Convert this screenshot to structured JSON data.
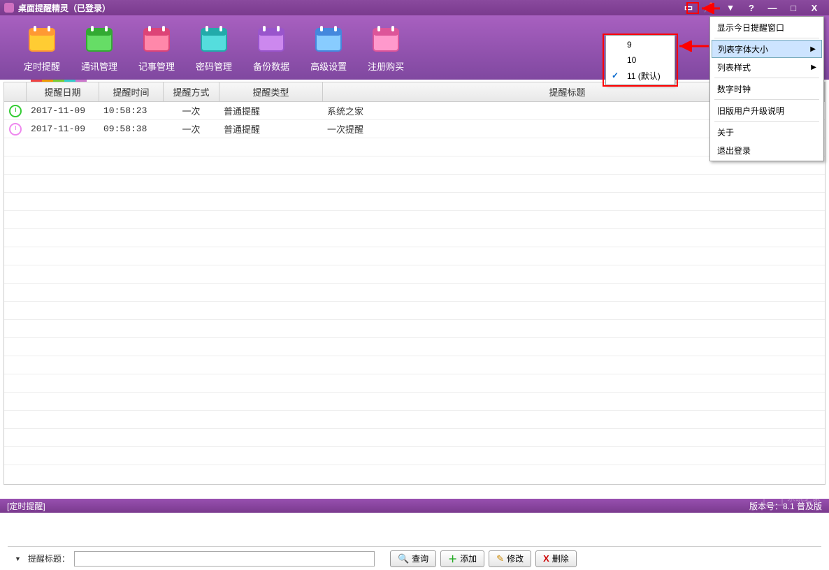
{
  "window": {
    "title": "桌面提醒精灵（已登录）"
  },
  "toolbar": [
    {
      "name": "timer-reminder",
      "label": "定时提醒",
      "color1": "#ffcc33",
      "color2": "#ff9933"
    },
    {
      "name": "contact-mgmt",
      "label": "通讯管理",
      "color1": "#66dd66",
      "color2": "#33aa33"
    },
    {
      "name": "note-mgmt",
      "label": "记事管理",
      "color1": "#ff88aa",
      "color2": "#dd4477"
    },
    {
      "name": "password-mgmt",
      "label": "密码管理",
      "color1": "#55dddd",
      "color2": "#22aaaa"
    },
    {
      "name": "backup-data",
      "label": "备份数据",
      "color1": "#cc88ee",
      "color2": "#9955cc"
    },
    {
      "name": "adv-settings",
      "label": "高级设置",
      "color1": "#88ccff",
      "color2": "#4488dd"
    },
    {
      "name": "register-buy",
      "label": "注册购买",
      "color1": "#ff99cc",
      "color2": "#dd5599"
    }
  ],
  "table": {
    "headers": {
      "date": "提醒日期",
      "time": "提醒时间",
      "mode": "提醒方式",
      "type": "提醒类型",
      "title": "提醒标题"
    },
    "rows": [
      {
        "icon": "clock-green",
        "date": "2017-11-09",
        "time": "10:58:23",
        "mode": "一次",
        "type": "普通提醒",
        "title": "系统之家"
      },
      {
        "icon": "clock-pink",
        "date": "2017-11-09",
        "time": "09:58:38",
        "mode": "一次",
        "type": "普通提醒",
        "title": "一次提醒"
      }
    ]
  },
  "search": {
    "label": "提醒标题：",
    "btn_search": "查询",
    "btn_add": "添加",
    "btn_edit": "修改",
    "btn_del": "删除"
  },
  "status": {
    "left": "[定时提醒]",
    "right": "版本号：8.1    普及版"
  },
  "menu": {
    "items": [
      {
        "label": "显示今日提醒窗口",
        "name": "show-today"
      },
      {
        "label": "列表字体大小",
        "name": "list-font-size",
        "sub": true,
        "hl": true
      },
      {
        "label": "列表样式",
        "name": "list-style",
        "sub": true
      },
      {
        "label": "数字时钟",
        "name": "digital-clock"
      },
      {
        "label": "旧版用户升级说明",
        "name": "upgrade-note"
      },
      {
        "label": "关于",
        "name": "about"
      },
      {
        "label": "退出登录",
        "name": "logout"
      }
    ]
  },
  "font_sizes": [
    {
      "label": "9",
      "checked": false
    },
    {
      "label": "10",
      "checked": false
    },
    {
      "label": "11 (默认)",
      "checked": true
    }
  ],
  "watermark": "系统之家"
}
